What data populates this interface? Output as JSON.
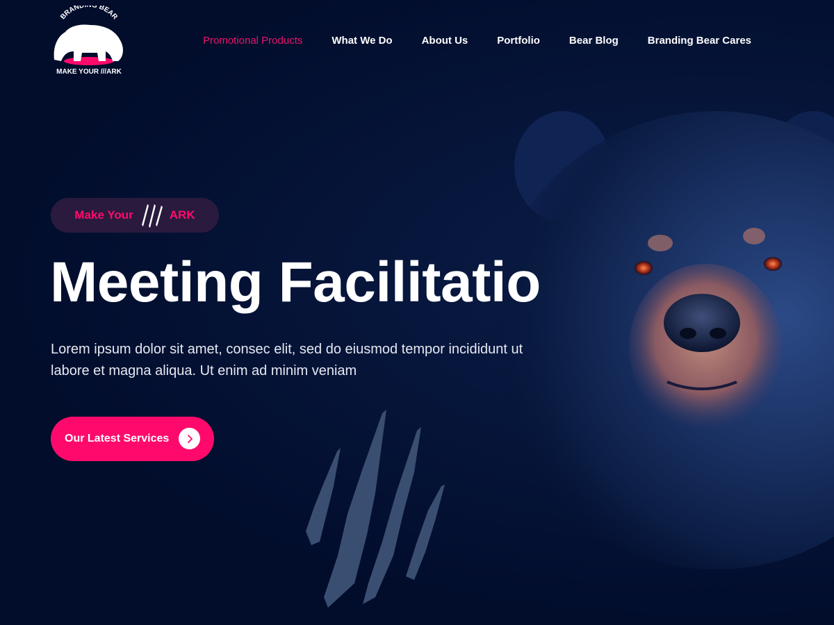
{
  "brand": {
    "logo_top_text": "BRANDING BEAR",
    "logo_bottom_text": "MAKE YOUR ///ARK"
  },
  "nav": {
    "items": [
      {
        "label": "Promotional Products",
        "active": true
      },
      {
        "label": "What We Do",
        "active": false
      },
      {
        "label": "About Us",
        "active": false
      },
      {
        "label": "Portfolio",
        "active": false
      },
      {
        "label": "Bear Blog",
        "active": false
      },
      {
        "label": "Branding Bear Cares",
        "active": false
      }
    ]
  },
  "hero": {
    "badge_left": "Make Your",
    "badge_right": "ARK",
    "headline": "Meeting Facilitatio",
    "subtext": "Lorem ipsum dolor sit amet, consec elit, sed do eiusmod tempor incididunt ut labore et magna aliqua. Ut enim ad minim veniam",
    "cta_label": "Our Latest Services"
  },
  "colors": {
    "background": "#020d2c",
    "accent": "#ff0a6c",
    "badge_bg": "#2a1a3e",
    "text": "#ffffff",
    "claw_marks": "#3a4e72"
  },
  "icons": {
    "badge_icon": "claw-marks-icon",
    "cta_icon": "chevron-right-icon",
    "decor_icon": "claw-marks-icon"
  }
}
